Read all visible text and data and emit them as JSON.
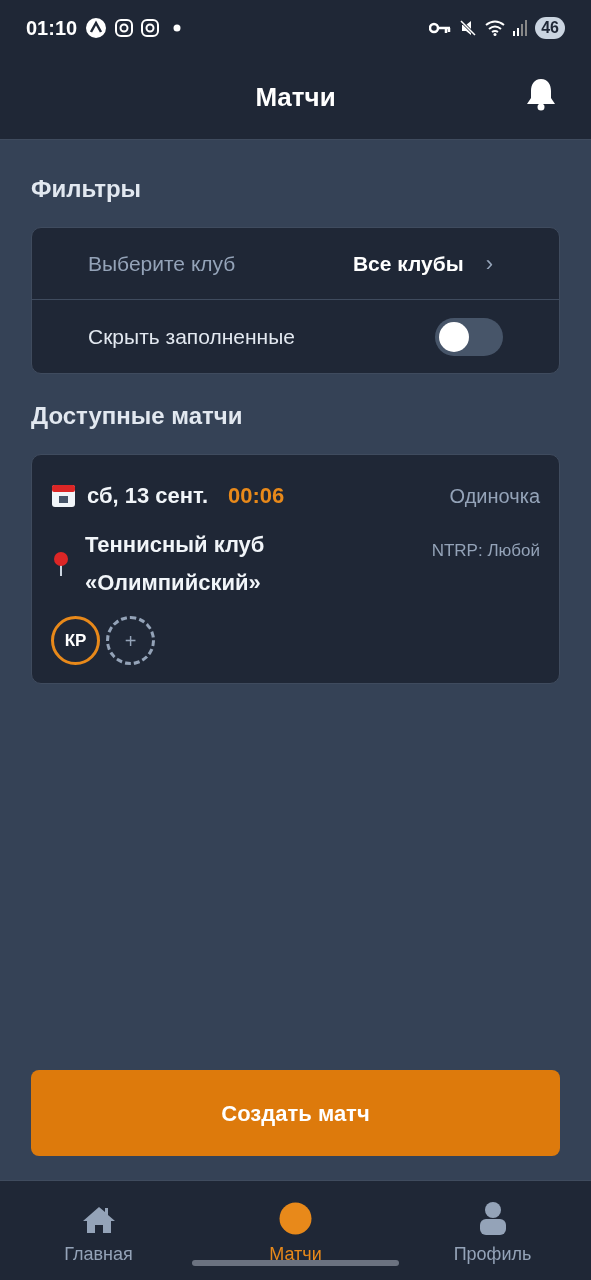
{
  "status_bar": {
    "time": "01:10",
    "battery": "46"
  },
  "header": {
    "title": "Матчи"
  },
  "filters": {
    "title": "Фильтры",
    "club": {
      "label": "Выберите клуб",
      "value": "Все клубы",
      "chevron": "›"
    },
    "hide_full": {
      "label": "Скрыть заполненные",
      "on": false
    }
  },
  "section_title": "Доступные матчи",
  "matches": [
    {
      "date": "сб, 13 сент.",
      "time": "00:06",
      "type": "Одиночка",
      "club": "Теннисный клуб «Олимпийский»",
      "ntrp": "NTRP: Любой",
      "players": [
        {
          "kind": "player",
          "text": "КР"
        },
        {
          "kind": "empty",
          "text": "+"
        }
      ]
    }
  ],
  "create_button": "Создать матч",
  "tab_bar": [
    {
      "label": "Главная",
      "kind": "home",
      "selected": false
    },
    {
      "label": "Матчи",
      "kind": "matches",
      "selected": true
    },
    {
      "label": "Профиль",
      "kind": "profile",
      "selected": false
    }
  ]
}
